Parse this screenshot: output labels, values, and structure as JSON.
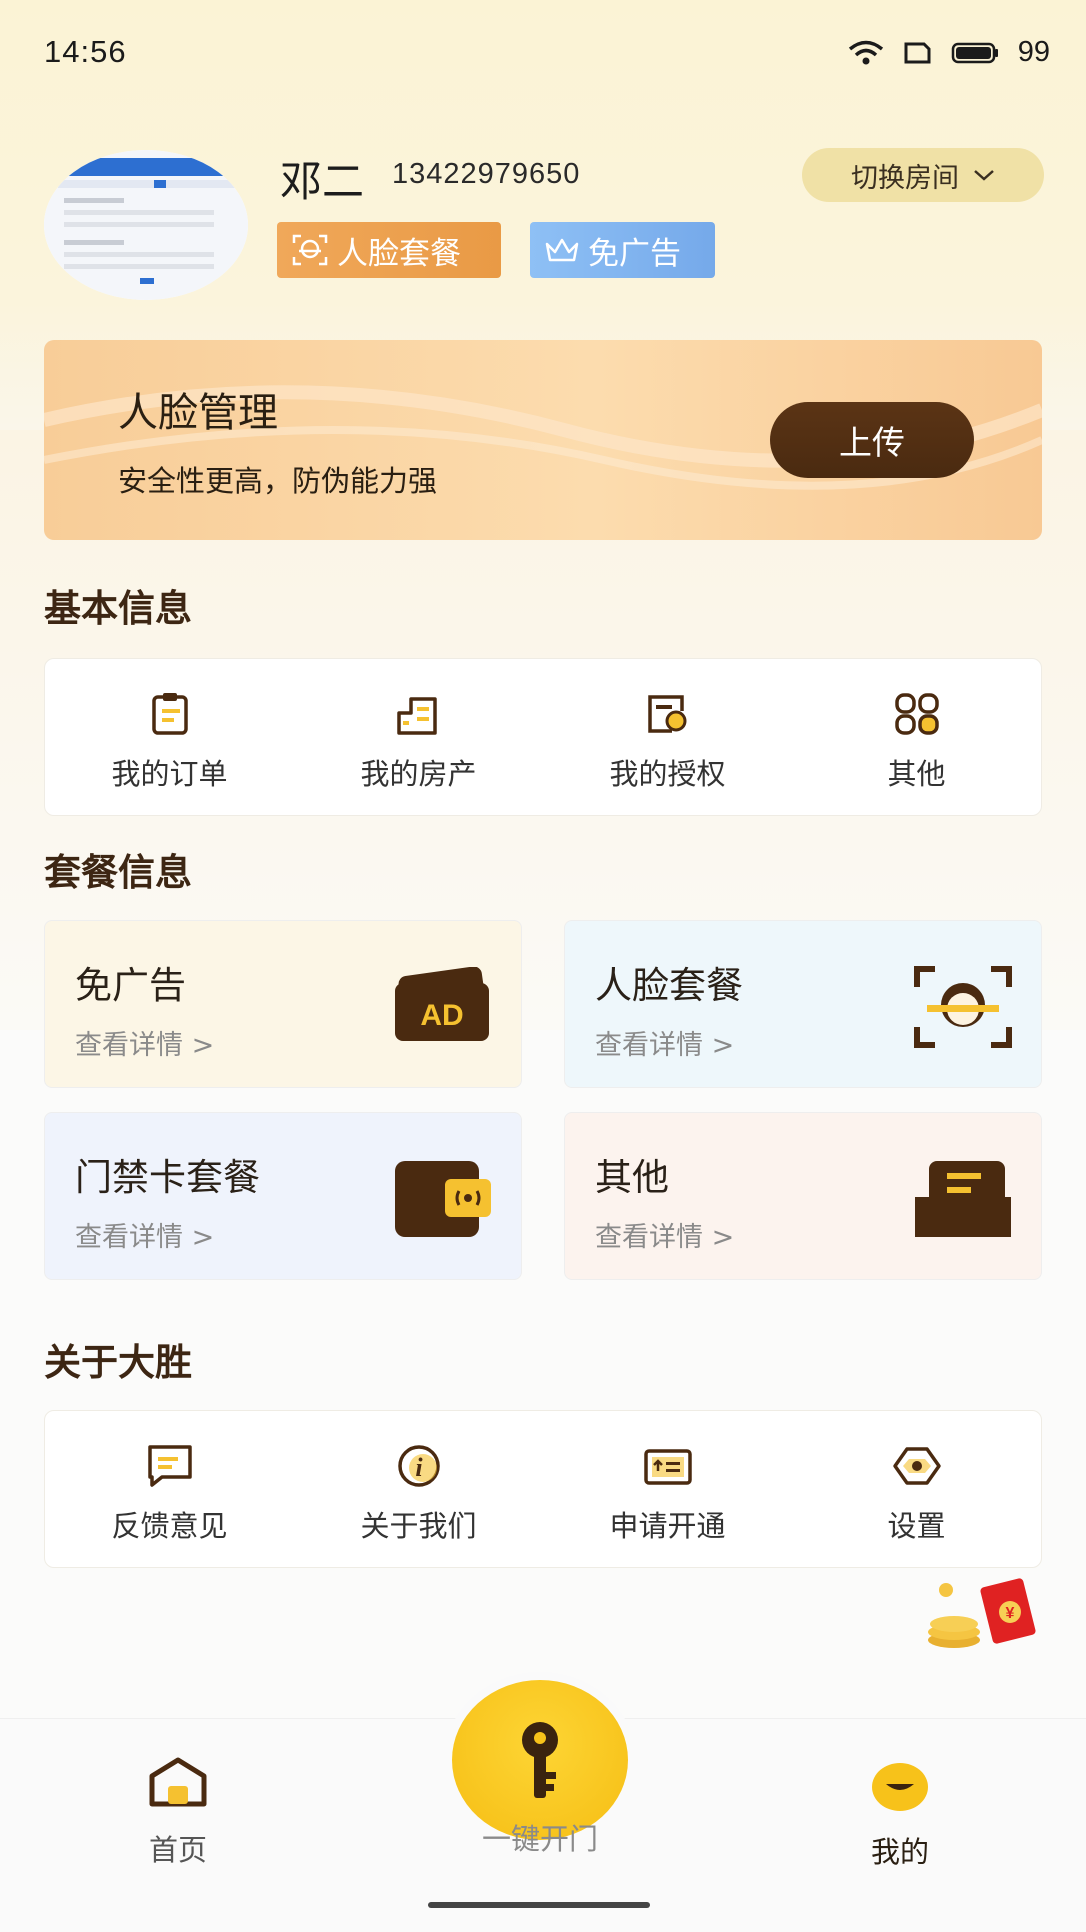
{
  "status_bar": {
    "time": "14:56",
    "battery": "99"
  },
  "profile": {
    "name": "邓二",
    "phone": "13422979650",
    "badges": [
      "人脸套餐",
      "免广告"
    ],
    "switch_room": "切换房间"
  },
  "banner": {
    "title": "人脸管理",
    "subtitle": "安全性更高，防伪能力强",
    "button": "上传"
  },
  "basic_info": {
    "title": "基本信息",
    "items": [
      {
        "label": "我的订单",
        "icon": "clipboard-icon"
      },
      {
        "label": "我的房产",
        "icon": "building-icon"
      },
      {
        "label": "我的授权",
        "icon": "certificate-icon"
      },
      {
        "label": "其他",
        "icon": "grid-icon"
      }
    ]
  },
  "packages": {
    "title": "套餐信息",
    "items": [
      {
        "title": "免广告",
        "link": "查看详情 >",
        "icon": "ad-icon",
        "bg": "#fcf6e6"
      },
      {
        "title": "人脸套餐",
        "link": "查看详情 >",
        "icon": "face-scan-icon",
        "bg": "#eef7fb"
      },
      {
        "title": "门禁卡套餐",
        "link": "查看详情 >",
        "icon": "access-card-icon",
        "bg": "#eff3fc"
      },
      {
        "title": "其他",
        "link": "查看详情 >",
        "icon": "inbox-icon",
        "bg": "#fcf3ee"
      }
    ]
  },
  "about": {
    "title": "关于大胜",
    "items": [
      {
        "label": "反馈意见",
        "icon": "message-icon"
      },
      {
        "label": "关于我们",
        "icon": "info-icon"
      },
      {
        "label": "申请开通",
        "icon": "apply-icon"
      },
      {
        "label": "设置",
        "icon": "settings-icon"
      }
    ]
  },
  "nav": {
    "home": "首页",
    "open": "一键开门",
    "mine": "我的"
  },
  "colors": {
    "accent_brown": "#4a2a10",
    "accent_yellow": "#f7c21a"
  }
}
